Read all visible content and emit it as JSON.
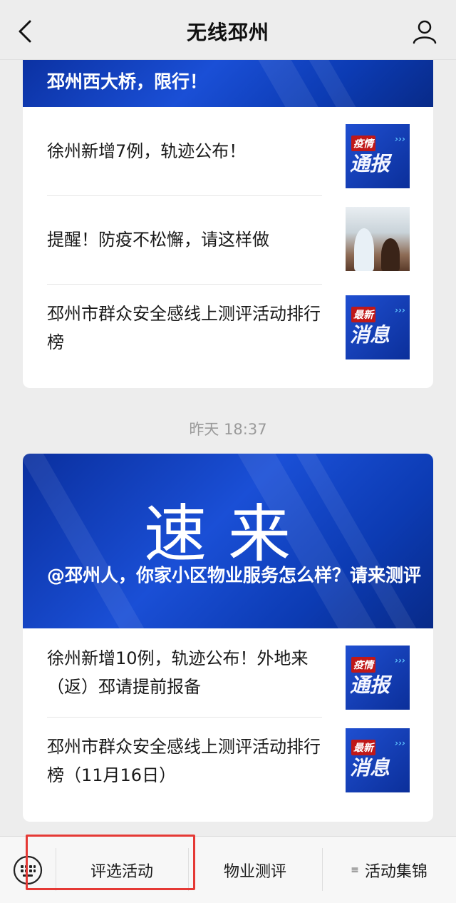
{
  "header": {
    "title": "无线邳州"
  },
  "card1": {
    "banner_title": "邳州西大桥，限行！",
    "items": [
      {
        "title": "徐州新增7例，轨迹公布！",
        "thumb_top": "疫情",
        "thumb_big": "通报"
      },
      {
        "title": "提醒！防疫不松懈，请这样做"
      },
      {
        "title": "邳州市群众安全感线上测评活动排行榜",
        "thumb_top": "最新",
        "thumb_big": "消息"
      }
    ]
  },
  "timestamp": "昨天 18:37",
  "card2": {
    "big_title": "速来",
    "banner_title": "@邳州人，你家小区物业服务怎么样？请来测评",
    "items": [
      {
        "title": "徐州新增10例，轨迹公布！外地来（返）邳请提前报备",
        "thumb_top": "疫情",
        "thumb_big": "通报"
      },
      {
        "title": "邳州市群众安全感线上测评活动排行榜（11月16日）",
        "thumb_top": "最新",
        "thumb_big": "消息"
      }
    ]
  },
  "bottom_menu": {
    "items": [
      "评选活动",
      "物业测评",
      "活动集锦"
    ]
  },
  "icons": {
    "back": "back-icon",
    "profile": "profile-icon",
    "keyboard": "keyboard-icon",
    "submenu": "submenu-icon"
  },
  "colors": {
    "highlight_box": "#e53935",
    "banner_blue": "#1a4fd6",
    "background": "#ededed"
  }
}
